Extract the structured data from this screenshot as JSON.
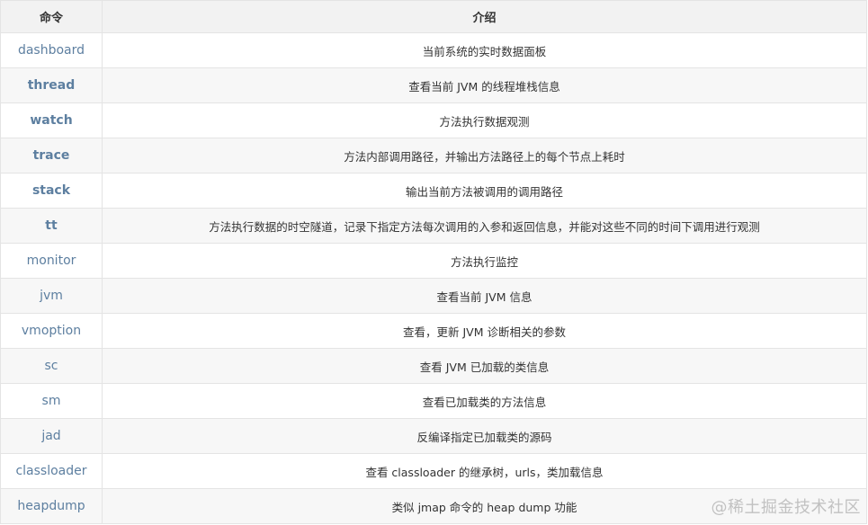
{
  "table": {
    "headers": [
      "命令",
      "介绍"
    ],
    "rows": [
      {
        "command": "dashboard",
        "bold": false,
        "description": "当前系统的实时数据面板"
      },
      {
        "command": "thread",
        "bold": true,
        "description": "查看当前 JVM 的线程堆栈信息"
      },
      {
        "command": "watch",
        "bold": true,
        "description": "方法执行数据观测"
      },
      {
        "command": "trace",
        "bold": true,
        "description": "方法内部调用路径，并输出方法路径上的每个节点上耗时"
      },
      {
        "command": "stack",
        "bold": true,
        "description": "输出当前方法被调用的调用路径"
      },
      {
        "command": "tt",
        "bold": true,
        "description": "方法执行数据的时空隧道，记录下指定方法每次调用的入参和返回信息，并能对这些不同的时间下调用进行观测"
      },
      {
        "command": "monitor",
        "bold": false,
        "description": "方法执行监控"
      },
      {
        "command": "jvm",
        "bold": false,
        "description": "查看当前 JVM 信息"
      },
      {
        "command": "vmoption",
        "bold": false,
        "description": "查看，更新 JVM 诊断相关的参数"
      },
      {
        "command": "sc",
        "bold": false,
        "description": "查看 JVM 已加载的类信息"
      },
      {
        "command": "sm",
        "bold": false,
        "description": "查看已加载类的方法信息"
      },
      {
        "command": "jad",
        "bold": false,
        "description": "反编译指定已加载类的源码"
      },
      {
        "command": "classloader",
        "bold": false,
        "description": "查看 classloader 的继承树，urls，类加载信息"
      },
      {
        "command": "heapdump",
        "bold": false,
        "description": "类似 jmap 命令的 heap dump 功能"
      }
    ]
  },
  "watermark": "@稀土掘金技术社区"
}
